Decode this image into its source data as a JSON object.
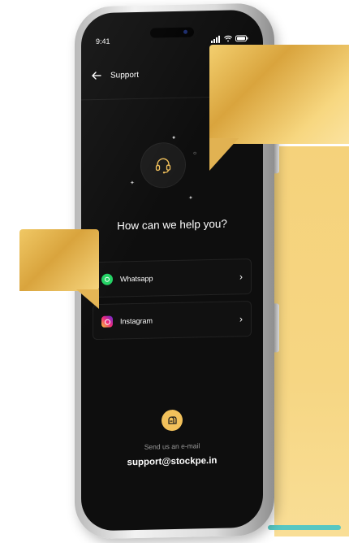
{
  "status_bar": {
    "time": "9:41"
  },
  "header": {
    "back_icon": "arrow-left-icon",
    "title": "Support"
  },
  "hero": {
    "icon": "headset-icon",
    "title": "How can we help you?"
  },
  "options": [
    {
      "label": "Whatsapp",
      "icon": "whatsapp-icon"
    },
    {
      "label": "Instagram",
      "icon": "instagram-icon"
    }
  ],
  "email_section": {
    "icon": "mailbox-icon",
    "caption": "Send us an e-mail",
    "address": "support@stockpe.in"
  },
  "colors": {
    "accent_gold": "#f2c15b",
    "screen_bg": "#0e0e0e",
    "whatsapp_green": "#25d366"
  }
}
